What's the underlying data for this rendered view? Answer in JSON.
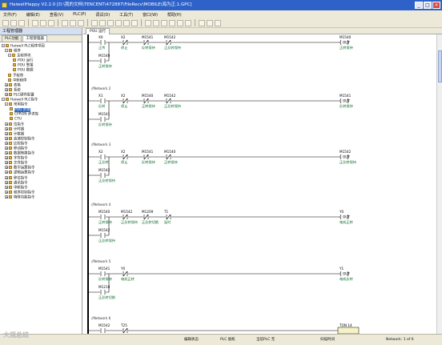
{
  "window": {
    "title": "HaiwellHappy V2.2.0 [D:\\我的文档\\TENCENT\\472887\\FileRecv\\MOBILE\\海为正.1.GPC]"
  },
  "menu": [
    "文件(F)",
    "编辑(E)",
    "查看(V)",
    "PLC(P)",
    "调试(D)",
    "工具(T)",
    "窗口(W)",
    "帮助(H)"
  ],
  "sidebar": {
    "title": "工程管理器",
    "tabs": [
      "PLC功能",
      "工程管理器"
    ],
    "tree": [
      {
        "label": "Haiwell PLC程序项目",
        "expander": "-"
      },
      {
        "label": "程序",
        "expander": "-"
      },
      {
        "label": "主程序块",
        "expander": "-"
      },
      {
        "label": "POU 运行",
        "expander": ""
      },
      {
        "label": "POU 警报",
        "expander": ""
      },
      {
        "label": "POU 数据",
        "expander": ""
      },
      {
        "label": "子程序",
        "expander": ""
      },
      {
        "label": "中断程序",
        "expander": ""
      },
      {
        "label": "表格",
        "expander": "+"
      },
      {
        "label": "系统",
        "expander": "+"
      },
      {
        "label": "PLC硬件配置",
        "expander": "+"
      },
      {
        "label": "Haiwell PLC指令",
        "expander": "-"
      },
      {
        "label": "常用指令",
        "expander": "-"
      },
      {
        "label": "POU 步进",
        "expander": "",
        "selected": true
      },
      {
        "label": "CPRON 步进库",
        "expander": ""
      },
      {
        "label": "CTU",
        "expander": ""
      },
      {
        "label": "位指令",
        "expander": "+"
      },
      {
        "label": "计时器",
        "expander": "+"
      },
      {
        "label": "计数器",
        "expander": "+"
      },
      {
        "label": "高速控制指令",
        "expander": "+"
      },
      {
        "label": "比较指令",
        "expander": "+"
      },
      {
        "label": "移动指令",
        "expander": "+"
      },
      {
        "label": "数据转换指令",
        "expander": "+"
      },
      {
        "label": "字符指令",
        "expander": "+"
      },
      {
        "label": "文件指令",
        "expander": "+"
      },
      {
        "label": "数学运算指令",
        "expander": "+"
      },
      {
        "label": "逻辑运算指令",
        "expander": "+"
      },
      {
        "label": "移位指令",
        "expander": "+"
      },
      {
        "label": "通讯指令",
        "expander": "+"
      },
      {
        "label": "中断指令",
        "expander": "+"
      },
      {
        "label": "程序控制指令",
        "expander": "+"
      },
      {
        "label": "特殊功能指令",
        "expander": "+"
      }
    ]
  },
  "editor": {
    "tab": "POU 运行",
    "networks": [
      {
        "label": "",
        "contacts": [
          {
            "addr": "X0",
            "desc": "正传",
            "type": "NO"
          },
          {
            "addr": "X2",
            "desc": "停止",
            "type": "NC"
          },
          {
            "addr": "M1541",
            "desc": "反转保持",
            "type": "NC"
          },
          {
            "addr": "M1542",
            "desc": "正反转保持",
            "type": "NC"
          }
        ],
        "coil": {
          "addr": "M1540",
          "desc": "正转保持"
        },
        "branch": {
          "addr": "M1540",
          "desc": "正转保持"
        }
      },
      {
        "label": "//Network 2",
        "contacts": [
          {
            "addr": "X1",
            "desc": "反转",
            "type": "NO"
          },
          {
            "addr": "X2",
            "desc": "停止",
            "type": "NC"
          },
          {
            "addr": "M1540",
            "desc": "正转保持",
            "type": "NC"
          },
          {
            "addr": "M1542",
            "desc": "正反转保持",
            "type": "NC"
          }
        ],
        "coil": {
          "addr": "M1541",
          "desc": "反转保持"
        },
        "branch": {
          "addr": "M1541",
          "desc": "反转保持"
        }
      },
      {
        "label": "//Network 3",
        "contacts": [
          {
            "addr": "X2",
            "desc": "正反转",
            "type": "NO"
          },
          {
            "addr": "X2",
            "desc": "停止",
            "type": "NC"
          },
          {
            "addr": "M1541",
            "desc": "反转保持",
            "type": "NC"
          },
          {
            "addr": "M1540",
            "desc": "正转保持",
            "type": "NC"
          }
        ],
        "coil": {
          "addr": "M1542",
          "desc": "正反转保持"
        },
        "branch": {
          "addr": "M1542",
          "desc": "正反转保持"
        }
      },
      {
        "label": "//Network 4",
        "contacts": [
          {
            "addr": "M1540",
            "desc": "正转保持",
            "type": "NO"
          },
          {
            "addr": "M1542",
            "desc": "正反转保持",
            "type": "NC"
          },
          {
            "addr": "M1209",
            "desc": "正反转切换",
            "type": "NC"
          },
          {
            "addr": "T1",
            "desc": "延时",
            "type": "NC"
          }
        ],
        "coil": {
          "addr": "Y0",
          "desc": "电机正转"
        },
        "branch": {
          "addr": "M1542",
          "desc": "正反转保持"
        }
      },
      {
        "label": "//Network 5",
        "contacts": [
          {
            "addr": "M1541",
            "desc": "反转保持",
            "type": "NO"
          },
          {
            "addr": "Y0",
            "desc": "电机正转",
            "type": "NC"
          }
        ],
        "coil": {
          "addr": "Y1",
          "desc": "电机反转"
        },
        "branch": {
          "addr": "M1210",
          "desc": "正反转切换"
        }
      },
      {
        "label": "//Network 6",
        "contacts": [
          {
            "addr": "M1542",
            "desc": "",
            "type": "NO"
          },
          {
            "addr": "T25",
            "desc": "",
            "type": "NC"
          }
        ],
        "coil": {
          "addr": "TON 14",
          "desc": "T25"
        },
        "branch": null
      }
    ]
  },
  "status": {
    "mode": "编辑状态",
    "plc": "PLC 脱机",
    "station": "当前PLC 无",
    "comm": "扫描时间",
    "network": "Network: 1 of 6"
  },
  "watermark": "大观总结"
}
